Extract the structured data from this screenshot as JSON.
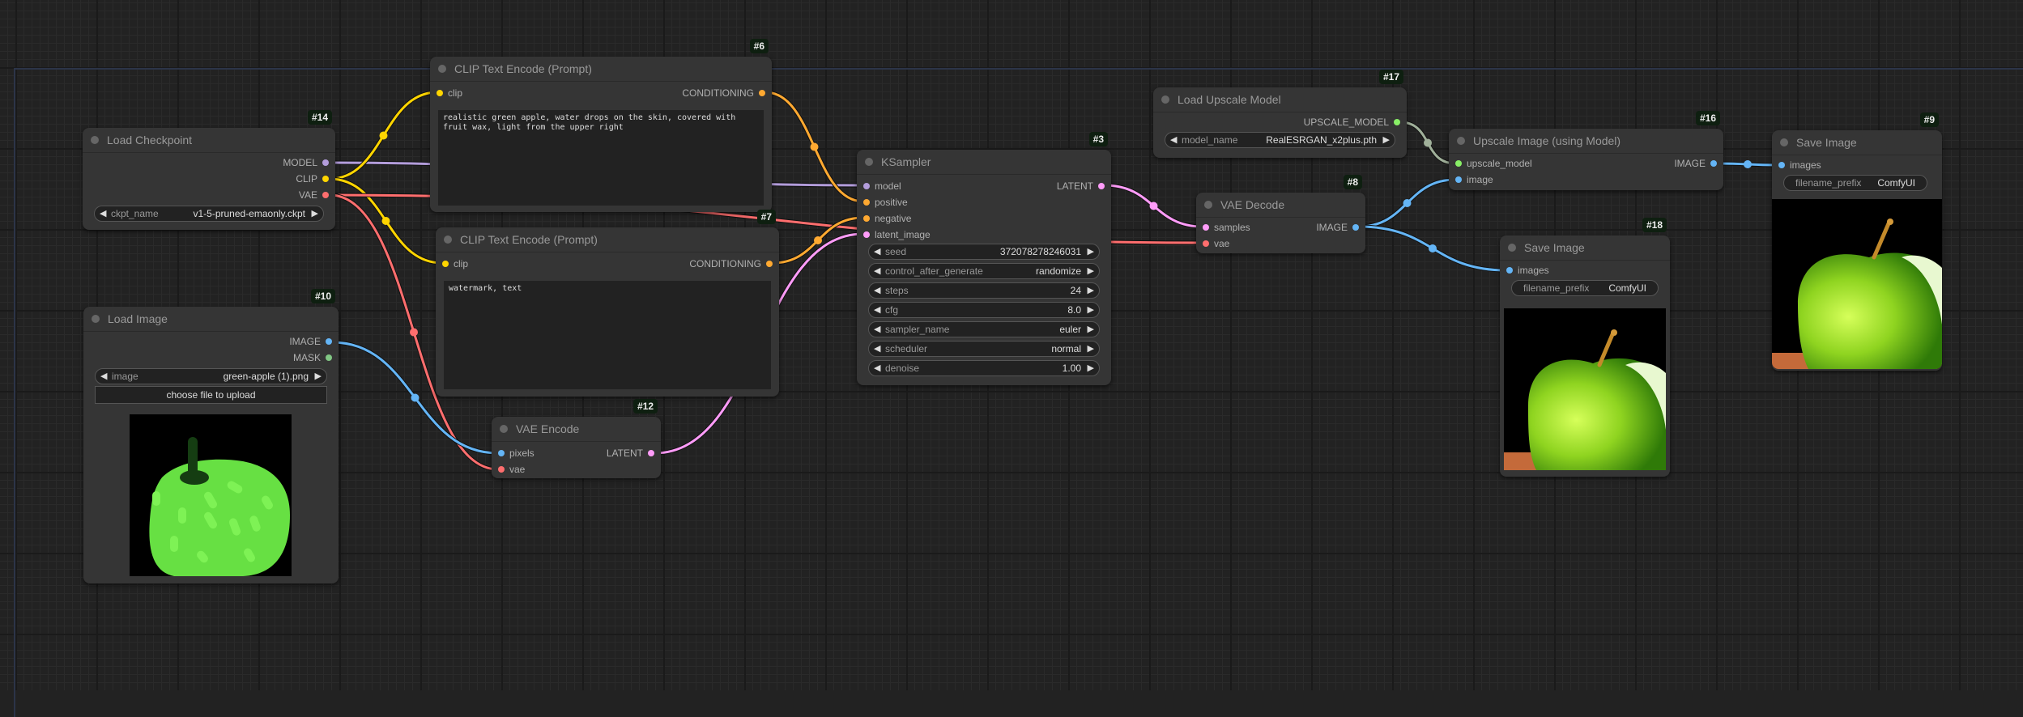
{
  "canvas": {
    "background": "#222222"
  },
  "colors": {
    "model": "#b39ddb",
    "clip": "#ffd500",
    "vae": "#ff6e6e",
    "conditioning": "#ffa931",
    "latent": "#ff9cf9",
    "image": "#64b5f6",
    "mask": "#81c784",
    "upscale_model": "#88ee66",
    "upscale_link": "#a0b09a"
  },
  "nodes": {
    "load_checkpoint": {
      "id": "#14",
      "title": "Load Checkpoint",
      "outputs": [
        "MODEL",
        "CLIP",
        "VAE"
      ],
      "widget": {
        "label": "ckpt_name",
        "value": "v1-5-pruned-emaonly.ckpt"
      }
    },
    "clip_pos": {
      "id": "#6",
      "title": "CLIP Text Encode (Prompt)",
      "input": "clip",
      "output": "CONDITIONING",
      "text": "realistic green apple, water drops on the skin, covered with\nfruit wax, light from the upper right"
    },
    "clip_neg": {
      "id": "#7",
      "title": "CLIP Text Encode (Prompt)",
      "input": "clip",
      "output": "CONDITIONING",
      "text": "watermark, text"
    },
    "load_image": {
      "id": "#10",
      "title": "Load Image",
      "outputs": [
        "IMAGE",
        "MASK"
      ],
      "widget": {
        "label": "image",
        "value": "green-apple (1).png"
      },
      "upload_label": "choose file to upload"
    },
    "vae_encode": {
      "id": "#12",
      "title": "VAE Encode",
      "inputs": [
        "pixels",
        "vae"
      ],
      "output": "LATENT"
    },
    "ksampler": {
      "id": "#3",
      "title": "KSampler",
      "inputs": [
        "model",
        "positive",
        "negative",
        "latent_image"
      ],
      "output": "LATENT",
      "widgets": [
        {
          "label": "seed",
          "value": "372078278246031"
        },
        {
          "label": "control_after_generate",
          "value": "randomize"
        },
        {
          "label": "steps",
          "value": "24"
        },
        {
          "label": "cfg",
          "value": "8.0"
        },
        {
          "label": "sampler_name",
          "value": "euler"
        },
        {
          "label": "scheduler",
          "value": "normal"
        },
        {
          "label": "denoise",
          "value": "1.00"
        }
      ]
    },
    "load_upscale": {
      "id": "#17",
      "title": "Load Upscale Model",
      "output": "UPSCALE_MODEL",
      "widget": {
        "label": "model_name",
        "value": "RealESRGAN_x2plus.pth"
      }
    },
    "vae_decode": {
      "id": "#8",
      "title": "VAE Decode",
      "inputs": [
        "samples",
        "vae"
      ],
      "output": "IMAGE"
    },
    "upscale_image": {
      "id": "#16",
      "title": "Upscale Image (using Model)",
      "inputs": [
        "upscale_model",
        "image"
      ],
      "output": "IMAGE"
    },
    "save_image_18": {
      "id": "#18",
      "title": "Save Image",
      "input": "images",
      "widget": {
        "label": "filename_prefix",
        "value": "ComfyUI"
      }
    },
    "save_image_9": {
      "id": "#9",
      "title": "Save Image",
      "input": "images",
      "widget": {
        "label": "filename_prefix",
        "value": "ComfyUI"
      }
    }
  }
}
